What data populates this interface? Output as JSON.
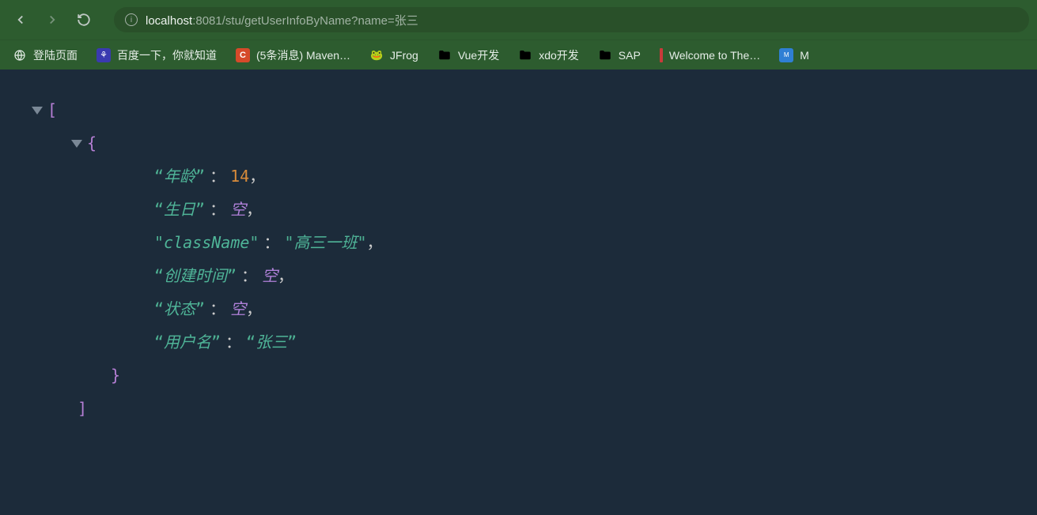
{
  "url": {
    "host": "localhost",
    "rest": ":8081/stu/getUserInfoByName?name=张三"
  },
  "bookmarks": [
    {
      "label": "登陆页面",
      "iconType": "globe"
    },
    {
      "label": "百度一下，你就知道",
      "iconType": "baidu"
    },
    {
      "label": "(5条消息) Maven…",
      "iconType": "csdn",
      "iconText": "C"
    },
    {
      "label": "JFrog",
      "iconType": "frog",
      "iconText": "⌂"
    },
    {
      "label": "Vue开发",
      "iconType": "folder"
    },
    {
      "label": "xdo开发",
      "iconType": "folder"
    },
    {
      "label": "SAP",
      "iconType": "folder"
    },
    {
      "label": "Welcome to The…",
      "iconType": "red"
    },
    {
      "label": "M",
      "iconType": "mdn",
      "iconText": "M"
    }
  ],
  "json": {
    "entries": [
      {
        "key": "年龄",
        "valueType": "number",
        "value": "14",
        "keyQuote": "“",
        "keyQuoteEnd": "”"
      },
      {
        "key": "生日",
        "valueType": "null",
        "value": "空",
        "keyQuote": "“",
        "keyQuoteEnd": "”"
      },
      {
        "key": "className",
        "valueType": "string",
        "value": "高三一班",
        "keyQuote": "\"",
        "keyQuoteEnd": "\"",
        "valQuote": "\"",
        "valQuoteEnd": "\""
      },
      {
        "key": "创建时间",
        "valueType": "null",
        "value": "空",
        "keyQuote": "“",
        "keyQuoteEnd": "”"
      },
      {
        "key": "状态",
        "valueType": "null",
        "value": "空",
        "keyQuote": "“",
        "keyQuoteEnd": "”"
      },
      {
        "key": "用户名",
        "valueType": "string",
        "value": "张三",
        "keyQuote": "“",
        "keyQuoteEnd": "”",
        "valQuote": "“",
        "valQuoteEnd": "”"
      }
    ],
    "openArr": "[",
    "closeArr": "]",
    "openObj": "{",
    "closeObj": "}"
  }
}
